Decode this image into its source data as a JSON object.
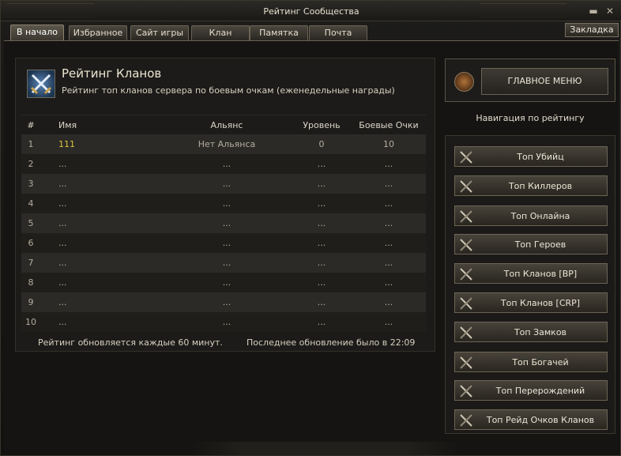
{
  "window": {
    "title": "Рейтинг Сообщества"
  },
  "tabs": [
    {
      "label": "В начало",
      "active": true
    },
    {
      "label": "Избранное",
      "active": false
    },
    {
      "label": "Сайт игры",
      "active": false
    },
    {
      "label": "Клан",
      "active": false
    },
    {
      "label": "Памятка",
      "active": false
    },
    {
      "label": "Почта",
      "active": false
    }
  ],
  "bookmark_label": "Закладка",
  "header": {
    "title": "Рейтинг Кланов",
    "subtitle": "Рейтинг топ кланов сервера по боевым очкам (еженедельные награды)",
    "icon": "crossed-swords-icon"
  },
  "table": {
    "columns": {
      "rank": "#",
      "name": "Имя",
      "alliance": "Альянс",
      "level": "Уровень",
      "points": "Боевые Очки"
    },
    "rows": [
      {
        "rank": "1",
        "name": "111",
        "alliance": "Нет Альянса",
        "level": "0",
        "points": "10"
      },
      {
        "rank": "2",
        "name": "...",
        "alliance": "...",
        "level": "...",
        "points": "..."
      },
      {
        "rank": "3",
        "name": "...",
        "alliance": "...",
        "level": "...",
        "points": "..."
      },
      {
        "rank": "4",
        "name": "...",
        "alliance": "...",
        "level": "...",
        "points": "..."
      },
      {
        "rank": "5",
        "name": "...",
        "alliance": "...",
        "level": "...",
        "points": "..."
      },
      {
        "rank": "6",
        "name": "...",
        "alliance": "...",
        "level": "...",
        "points": "..."
      },
      {
        "rank": "7",
        "name": "...",
        "alliance": "...",
        "level": "...",
        "points": "..."
      },
      {
        "rank": "8",
        "name": "...",
        "alliance": "...",
        "level": "...",
        "points": "..."
      },
      {
        "rank": "9",
        "name": "...",
        "alliance": "...",
        "level": "...",
        "points": "..."
      },
      {
        "rank": "10",
        "name": "...",
        "alliance": "...",
        "level": "...",
        "points": "..."
      }
    ]
  },
  "footer": {
    "update_interval": "Рейтинг обновляется каждые 60 минут.",
    "last_update": "Последнее обновление было в 22:09"
  },
  "main_menu_label": "ГЛАВНОЕ МЕНЮ",
  "nav": {
    "title": "Навигация по рейтингу",
    "items": [
      "Топ Убийц",
      "Топ Киллеров",
      "Топ Онлайна",
      "Топ Героев",
      "Топ Кланов [BP]",
      "Топ Кланов [CRP]",
      "Топ Замков",
      "Топ Богачей",
      "Топ Перерождений",
      "Топ Рейд Очков Кланов"
    ]
  },
  "colors": {
    "accent": "#d9c33d",
    "text": "#d8d2c4",
    "panel": "#1c1b19"
  }
}
